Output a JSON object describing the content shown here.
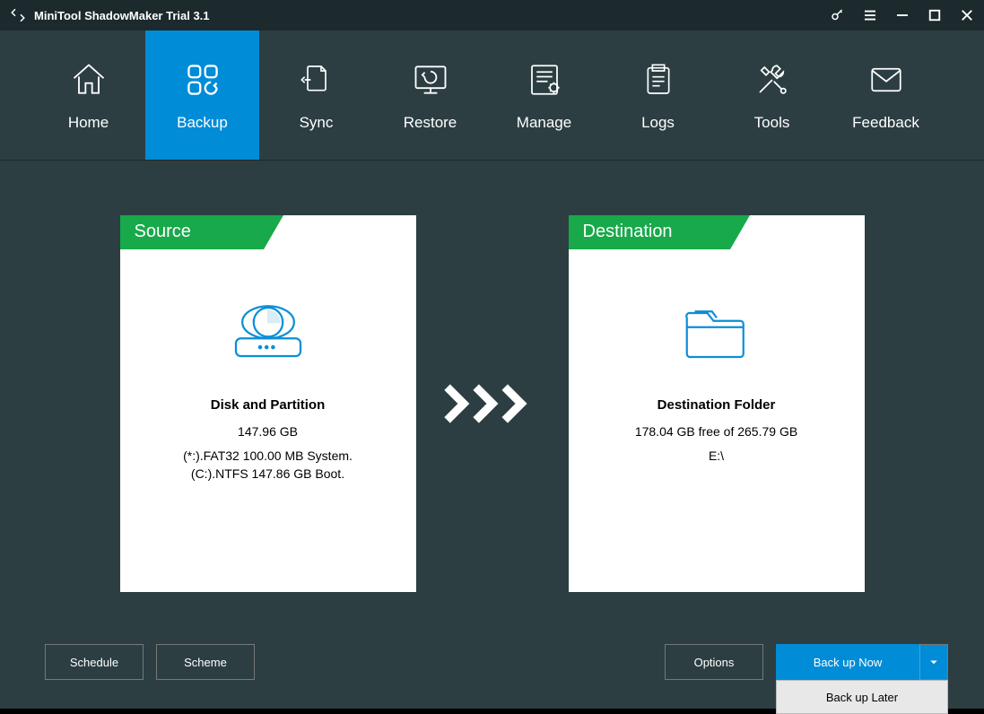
{
  "app": {
    "title": "MiniTool ShadowMaker Trial 3.1"
  },
  "nav": {
    "items": [
      {
        "label": "Home"
      },
      {
        "label": "Backup"
      },
      {
        "label": "Sync"
      },
      {
        "label": "Restore"
      },
      {
        "label": "Manage"
      },
      {
        "label": "Logs"
      },
      {
        "label": "Tools"
      },
      {
        "label": "Feedback"
      }
    ]
  },
  "source": {
    "header": "Source",
    "title": "Disk and Partition",
    "size": "147.96 GB",
    "line1": "(*:).FAT32 100.00 MB System.",
    "line2": "(C:).NTFS 147.86 GB Boot."
  },
  "destination": {
    "header": "Destination",
    "title": "Destination Folder",
    "free": "178.04 GB free of 265.79 GB",
    "path": "E:\\"
  },
  "buttons": {
    "schedule": "Schedule",
    "scheme": "Scheme",
    "options": "Options",
    "backup_now": "Back up Now",
    "backup_later": "Back up Later"
  }
}
